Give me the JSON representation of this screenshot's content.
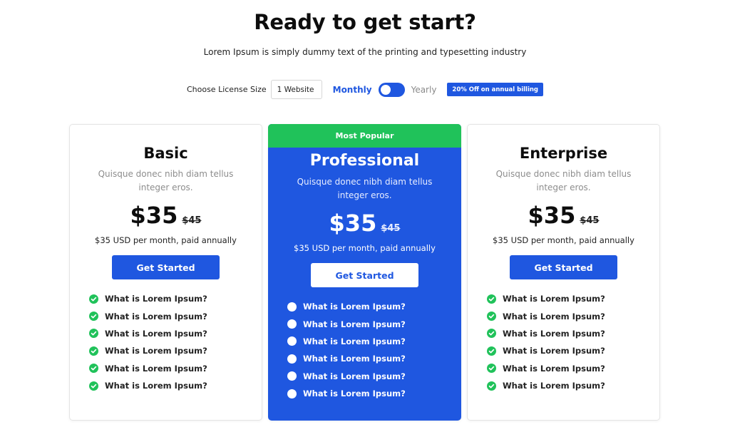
{
  "header": {
    "title": "Ready to get start?",
    "subtitle": "Lorem Ipsum is simply dummy text of the printing and typesetting industry"
  },
  "controls": {
    "license_label": "Choose License Size",
    "license_value": "1 Website",
    "monthly_label": "Monthly",
    "yearly_label": "Yearly",
    "billing_toggle": "monthly",
    "discount_badge": "20% Off on annual billing"
  },
  "colors": {
    "accent": "#1f57e0",
    "success": "#20c25a"
  },
  "plans": [
    {
      "name": "Basic",
      "description": "Quisque donec nibh diam tellus integer eros.",
      "price": "$35",
      "old_price": "$45",
      "billing": "$35 USD per month, paid annually",
      "cta": "Get Started",
      "features": [
        "What is Lorem Ipsum?",
        "What is Lorem Ipsum?",
        "What is Lorem Ipsum?",
        "What is Lorem Ipsum?",
        "What is Lorem Ipsum?",
        "What is Lorem Ipsum?"
      ]
    },
    {
      "badge": "Most Popular",
      "name": "Professional",
      "description": "Quisque donec nibh diam tellus integer eros.",
      "price": "$35",
      "old_price": "$45",
      "billing": "$35 USD per month, paid annually",
      "cta": "Get Started",
      "features": [
        "What is Lorem Ipsum?",
        "What is Lorem Ipsum?",
        "What is Lorem Ipsum?",
        "What is Lorem Ipsum?",
        "What is Lorem Ipsum?",
        "What is Lorem Ipsum?"
      ]
    },
    {
      "name": "Enterprise",
      "description": "Quisque donec nibh diam tellus integer eros.",
      "price": "$35",
      "old_price": "$45",
      "billing": "$35 USD per month, paid annually",
      "cta": "Get Started",
      "features": [
        "What is Lorem Ipsum?",
        "What is Lorem Ipsum?",
        "What is Lorem Ipsum?",
        "What is Lorem Ipsum?",
        "What is Lorem Ipsum?",
        "What is Lorem Ipsum?"
      ]
    }
  ]
}
